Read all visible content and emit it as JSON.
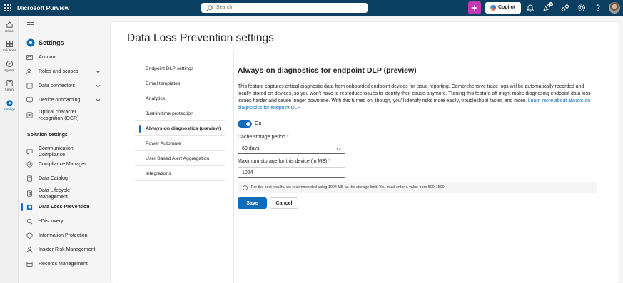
{
  "app": {
    "name": "Microsoft Purview",
    "search_placeholder": "Search",
    "copilot_label": "Copilot",
    "notification_count": "1"
  },
  "rail": {
    "items": [
      {
        "label": "Home",
        "icon": "home-icon"
      },
      {
        "label": "Solutions",
        "icon": "solutions-icon"
      },
      {
        "label": "Agents",
        "icon": "agents-icon"
      },
      {
        "label": "Learn",
        "icon": "learn-icon"
      },
      {
        "label": "Settings",
        "icon": "gear-icon",
        "active": true
      }
    ]
  },
  "nav": {
    "title": "Settings",
    "items": [
      {
        "label": "Account",
        "icon": "account-icon"
      },
      {
        "label": "Roles and scopes",
        "icon": "roles-icon",
        "expandable": true
      },
      {
        "label": "Data connectors",
        "icon": "connectors-icon",
        "expandable": true
      },
      {
        "label": "Device onboarding",
        "icon": "device-icon",
        "expandable": true
      },
      {
        "label": "Optical character recognition (OCR)",
        "icon": "ocr-icon"
      }
    ],
    "section_title": "Solution settings",
    "solution_items": [
      {
        "label": "Communication Compliance",
        "icon": "communication-icon"
      },
      {
        "label": "Compliance Manager",
        "icon": "compliance-icon"
      },
      {
        "label": "Data Catalog",
        "icon": "catalog-icon"
      },
      {
        "label": "Data Lifecycle Management",
        "icon": "lifecycle-icon"
      },
      {
        "label": "Data Loss Prevention",
        "icon": "dlp-icon",
        "active": true
      },
      {
        "label": "eDiscovery",
        "icon": "ediscovery-icon"
      },
      {
        "label": "Information Protection",
        "icon": "protection-icon"
      },
      {
        "label": "Insider Risk Management",
        "icon": "insider-icon"
      },
      {
        "label": "Records Management",
        "icon": "records-icon"
      }
    ]
  },
  "page": {
    "title": "Data Loss Prevention settings",
    "subnav": [
      {
        "label": "Endpoint DLP settings"
      },
      {
        "label": "Email templates"
      },
      {
        "label": "Analytics"
      },
      {
        "label": "Just-in-time protection"
      },
      {
        "label": "Always-on diagnostics (preview)",
        "active": true
      },
      {
        "label": "Power Automate"
      },
      {
        "label": "User Based Alert Aggregation"
      },
      {
        "label": "Integrations"
      }
    ]
  },
  "content": {
    "title": "Always-on diagnostics for endpoint DLP (preview)",
    "description": "This feature captures critical diagnostic data from onboarded endpoint devices for issue reporting. Comprehensive trace logs will be automatically recorded and locally stored on devices, so you won't have to reproduce issues to identify their cause anymore. Turning this feature off might make diagnosing endpoint data loss issues harder and cause longer downtime. With this turned on, though, you'll identify risks more easily, troubleshoot faster, and more.",
    "learn_more": "Learn more about always-on diagnostics for endpoint DLP",
    "toggle_state": "On",
    "cache_label": "Cache storage period",
    "cache_value": "60 days",
    "storage_label": "Maximum storage for this device (in MB)",
    "storage_value": "1024",
    "required_mark": "*",
    "info_text": "For the best results, we recommended using 1024 MB as the storage limit. You must enter a value from 500-1500.",
    "save_label": "Save",
    "cancel_label": "Cancel"
  },
  "colors": {
    "topbar": "#0b3f61",
    "accent": "#0f6cbd",
    "copilot_icon_bg": "#c239b3"
  }
}
